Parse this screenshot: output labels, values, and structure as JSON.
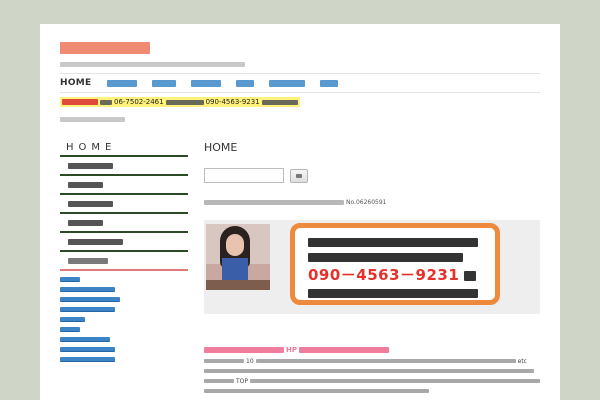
{
  "nav": {
    "home_label": "HOME"
  },
  "notice": {
    "tel": "06-7502-2461",
    "mobile": "090-4563-9231"
  },
  "sidebar": {
    "home_label": "HOME"
  },
  "main": {
    "title": "HOME",
    "registration_no": "No.06260591",
    "banner": {
      "phone": "090－4563－9231"
    },
    "article_title_text": "HP",
    "body": {
      "line1_num": "10",
      "line1_tail": "etc",
      "line3_word": "TOP"
    }
  }
}
